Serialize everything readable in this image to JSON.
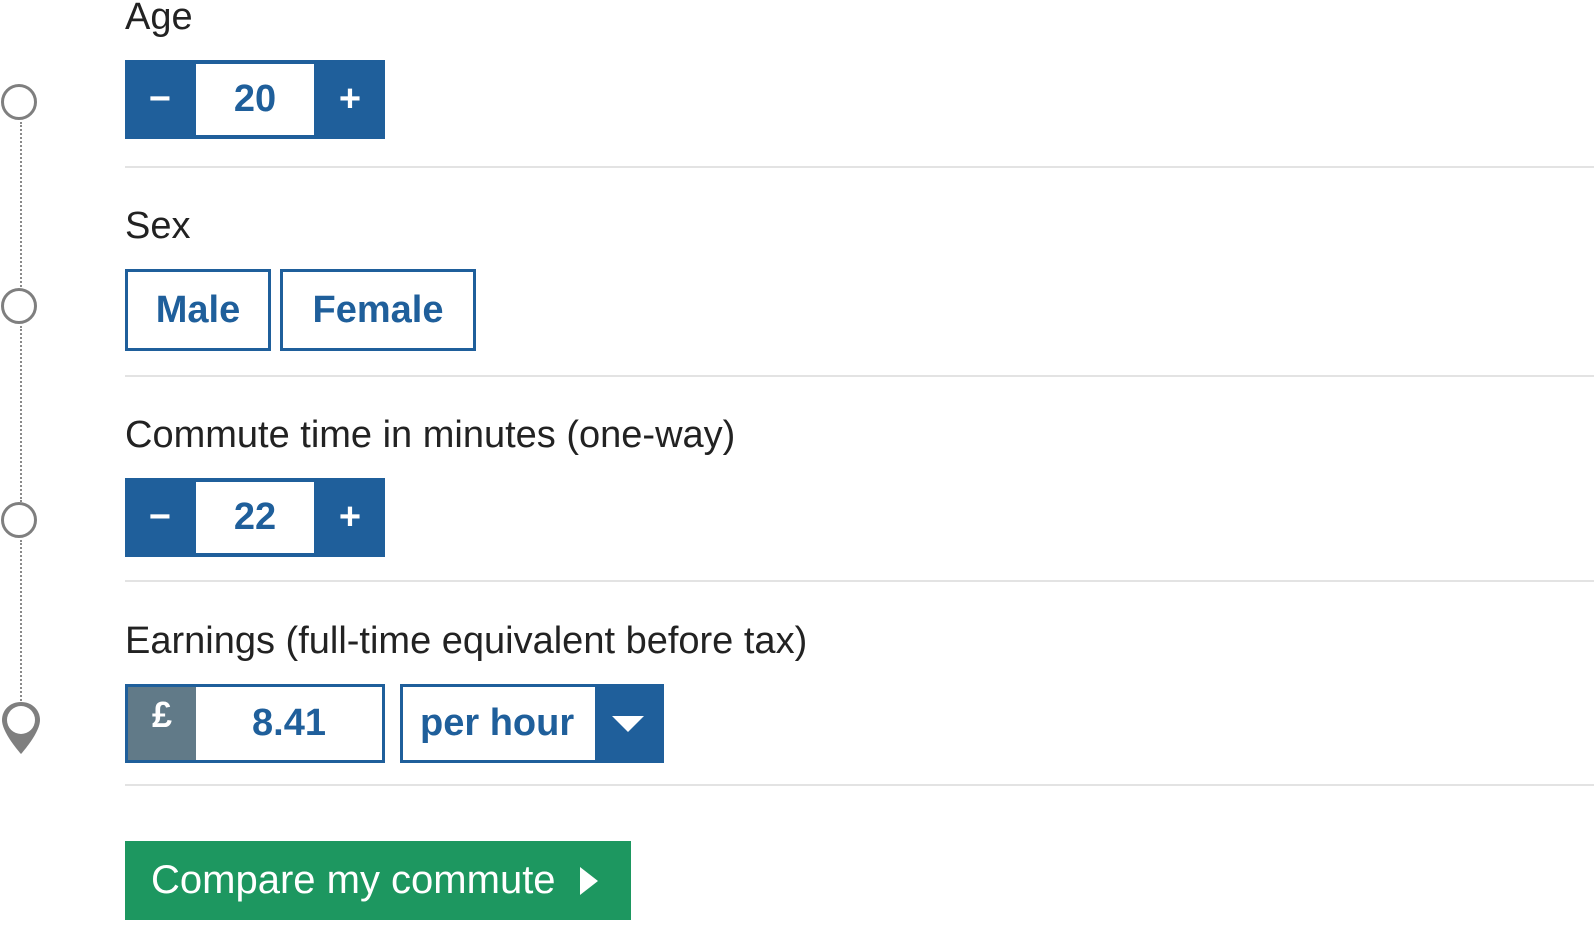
{
  "colors": {
    "primary": "#1f5f9b",
    "currency_bg": "#617a88",
    "submit": "#1d9760",
    "timeline": "#7f7f7f"
  },
  "form": {
    "age": {
      "label": "Age",
      "minus": "−",
      "plus": "+",
      "value": "20"
    },
    "sex": {
      "label": "Sex",
      "options": [
        "Male",
        "Female"
      ]
    },
    "commute": {
      "label": "Commute time in minutes (one-way)",
      "minus": "−",
      "plus": "+",
      "value": "22"
    },
    "earnings": {
      "label": "Earnings (full-time equivalent before tax)",
      "currency": "£",
      "amount": "8.41",
      "period": "per hour"
    },
    "submit_label": "Compare my commute"
  },
  "icons": {
    "timeline_steps": "circle-icon",
    "timeline_end": "map-pin-icon",
    "dropdown": "chevron-down-icon",
    "submit": "arrow-right-icon"
  }
}
